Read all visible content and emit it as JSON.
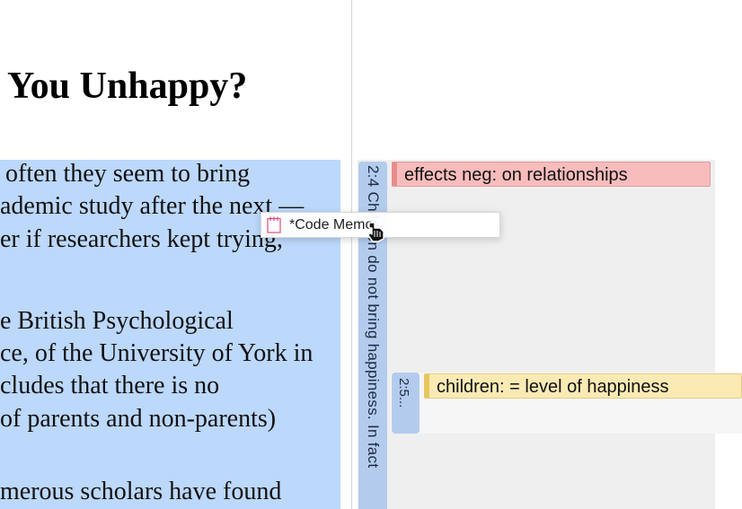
{
  "document": {
    "title": "You Unhappy?",
    "lines": [
      "often they seem to bring",
      "ademic study after the next —",
      "er if researchers kept trying,",
      "",
      "e British Psychological",
      "ce, of the University of York in",
      "cludes that there is no",
      "of parents and non-parents)",
      "",
      "merous scholars have found"
    ]
  },
  "margin": {
    "quotation_label": "2:4 Children do not bring happiness. In fact",
    "sub_quotation_label": "2:5...",
    "codes": [
      {
        "label": "effects neg: on relationships",
        "color": "#f9bcbc"
      },
      {
        "label": "children: = level of happiness",
        "color": "#fbeab4"
      }
    ]
  },
  "drag": {
    "label": "*Code Memo",
    "icon": "memo-icon"
  },
  "colors": {
    "selection": "#bcd8fb",
    "quotation_bar": "#b3ccee"
  }
}
